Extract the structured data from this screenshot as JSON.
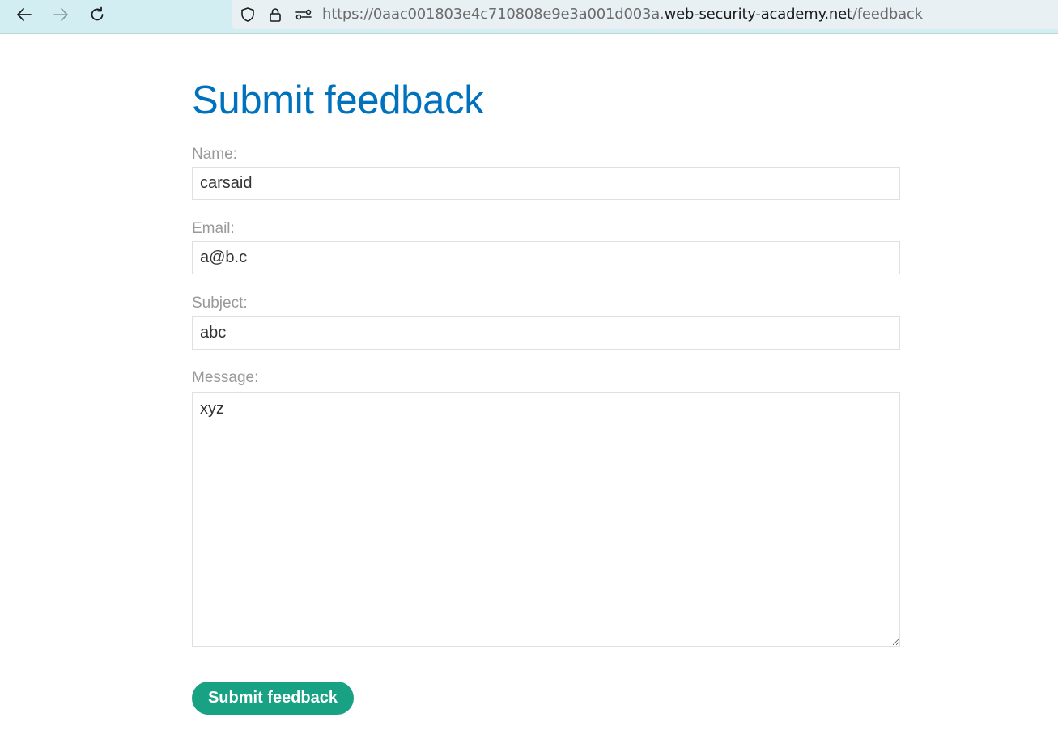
{
  "browser": {
    "url_prefix": "https://0aac001803e4c710808e9e3a001d003a.",
    "url_host": "web-security-academy.net",
    "url_path": "/feedback",
    "icons": [
      "back-arrow-icon",
      "forward-arrow-icon",
      "reload-icon",
      "shield-icon",
      "lock-icon",
      "permissions-icon"
    ]
  },
  "page": {
    "title": "Submit feedback"
  },
  "form": {
    "name_label": "Name:",
    "name_value": "carsaid",
    "email_label": "Email:",
    "email_value": "a@b.c",
    "subject_label": "Subject:",
    "subject_value": "abc",
    "message_label": "Message:",
    "message_value": "xyz",
    "submit_label": "Submit feedback"
  },
  "colors": {
    "title": "#0071bc",
    "label": "#999999",
    "button": "#18a182",
    "toolbar": "#d3eef2"
  }
}
